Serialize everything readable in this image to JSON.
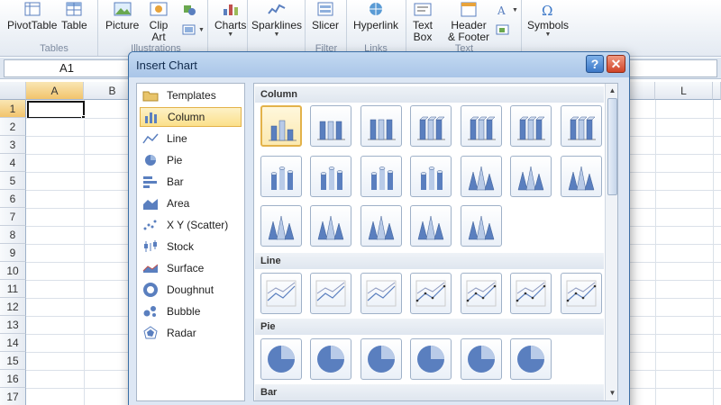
{
  "ribbon": {
    "tables": {
      "pivottable": "PivotTable",
      "table": "Table",
      "group": "Tables"
    },
    "illustrations": {
      "picture": "Picture",
      "clip_art_line1": "Clip",
      "clip_art_line2": "Art",
      "group": "Illustrations"
    },
    "charts": "Charts",
    "sparklines": "Sparklines",
    "slicer": "Slicer",
    "filter_group": "Filter",
    "hyperlink": "Hyperlink",
    "links_group": "Links",
    "text_box_line1": "Text",
    "text_box_line2": "Box",
    "header_line1": "Header",
    "header_line2": "& Footer",
    "text_group": "Text",
    "symbols": "Symbols"
  },
  "formula_bar": {
    "name_box": "A1"
  },
  "grid": {
    "columns": [
      "A",
      "B",
      "L"
    ],
    "rows": [
      "1",
      "2",
      "3",
      "4",
      "5",
      "6",
      "7",
      "8",
      "9",
      "10",
      "11",
      "12",
      "13",
      "14",
      "15",
      "16",
      "17"
    ]
  },
  "dialog": {
    "title": "Insert Chart",
    "help": "?",
    "close": "✕",
    "chart_types": [
      "Templates",
      "Column",
      "Line",
      "Pie",
      "Bar",
      "Area",
      "X Y (Scatter)",
      "Stock",
      "Surface",
      "Doughnut",
      "Bubble",
      "Radar"
    ],
    "selected_type": "Column",
    "sections": {
      "column": "Column",
      "line": "Line",
      "pie": "Pie",
      "bar": "Bar"
    }
  },
  "colors": {
    "accent": "#3c78c8",
    "selection": "#fbe08a",
    "chart_blue": "#5a7fbf"
  }
}
